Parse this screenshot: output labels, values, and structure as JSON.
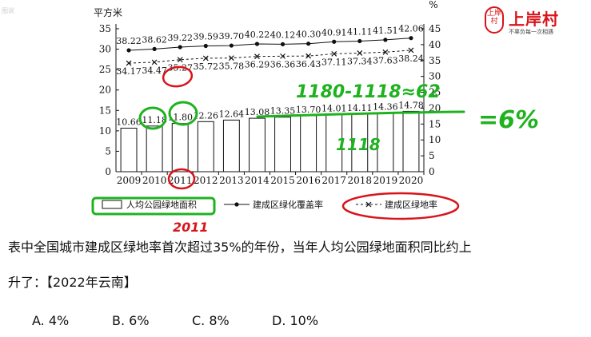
{
  "chart_data": {
    "type": "bar",
    "categories": [
      "2009",
      "2010",
      "2011",
      "2012",
      "2013",
      "2014",
      "2015",
      "2016",
      "2017",
      "2018",
      "2019",
      "2020"
    ],
    "bar_series": {
      "name": "人均公园绿地面积",
      "values": [
        10.66,
        11.18,
        11.8,
        12.26,
        12.64,
        13.08,
        13.35,
        13.7,
        14.01,
        14.11,
        14.36,
        14.78
      ],
      "labels": [
        "10.66",
        "11.18",
        "11.80",
        "12.26",
        "12.64",
        "13.08",
        "13.35",
        "13.70",
        "14.01",
        "14.11",
        "14.36",
        "14.78"
      ]
    },
    "line_series": [
      {
        "name": "建成区绿化覆盖率",
        "marker": "dot",
        "values": [
          38.22,
          38.62,
          39.22,
          39.59,
          39.7,
          40.22,
          40.12,
          40.3,
          40.91,
          41.11,
          41.51,
          42.06
        ],
        "labels": [
          "38.22",
          "38.62",
          "39.22",
          "39.59",
          "39.70",
          "40.22",
          "40.12",
          "40.30",
          "40.91",
          "41.11",
          "41.51",
          "42.06"
        ]
      },
      {
        "name": "建成区绿地率",
        "marker": "x",
        "values": [
          34.17,
          34.47,
          35.27,
          35.72,
          35.78,
          36.29,
          36.36,
          36.43,
          37.11,
          37.34,
          37.63,
          38.24
        ],
        "labels": [
          "34.17",
          "34.47",
          "35.27",
          "35.72",
          "35.78",
          "36.29",
          "36.36",
          "36.43",
          "37.11",
          "37.34",
          "37.63",
          "38.24"
        ]
      }
    ],
    "left_axis": {
      "unit": "平方米",
      "ylim": [
        0,
        35
      ],
      "ticks": [
        "0",
        "5",
        "10",
        "15",
        "20",
        "25",
        "30",
        "35"
      ]
    },
    "right_axis": {
      "unit": "%",
      "ylim": [
        0,
        45
      ],
      "ticks": [
        "0",
        "5",
        "10",
        "15",
        "20",
        "25",
        "30",
        "35",
        "40",
        "45"
      ]
    },
    "legend": {
      "position": "bottom",
      "items": [
        "人均公园绿地面积",
        "建成区绿化覆盖率",
        "建成区绿地率"
      ]
    }
  },
  "annotations": {
    "calc": "1180-1118≈62",
    "base": "1118",
    "result": "=6%",
    "year": "2011"
  },
  "brand": {
    "seal_text": "上岸村",
    "name": "上岸村",
    "slogan": "不辜负每一次相遇",
    "corner": "图说"
  },
  "question": {
    "line1": "表中全国城市建成区绿地率首次超过35%的年份，当年人均公园绿地面积同比约上",
    "line2": "升了：【2022年云南】",
    "options": [
      "A. 4%",
      "B. 6%",
      "C. 8%",
      "D. 10%"
    ]
  },
  "colors": {
    "annotation_green": "#1fb21f",
    "annotation_red": "#d8141a",
    "brand_red": "#d8141a"
  }
}
